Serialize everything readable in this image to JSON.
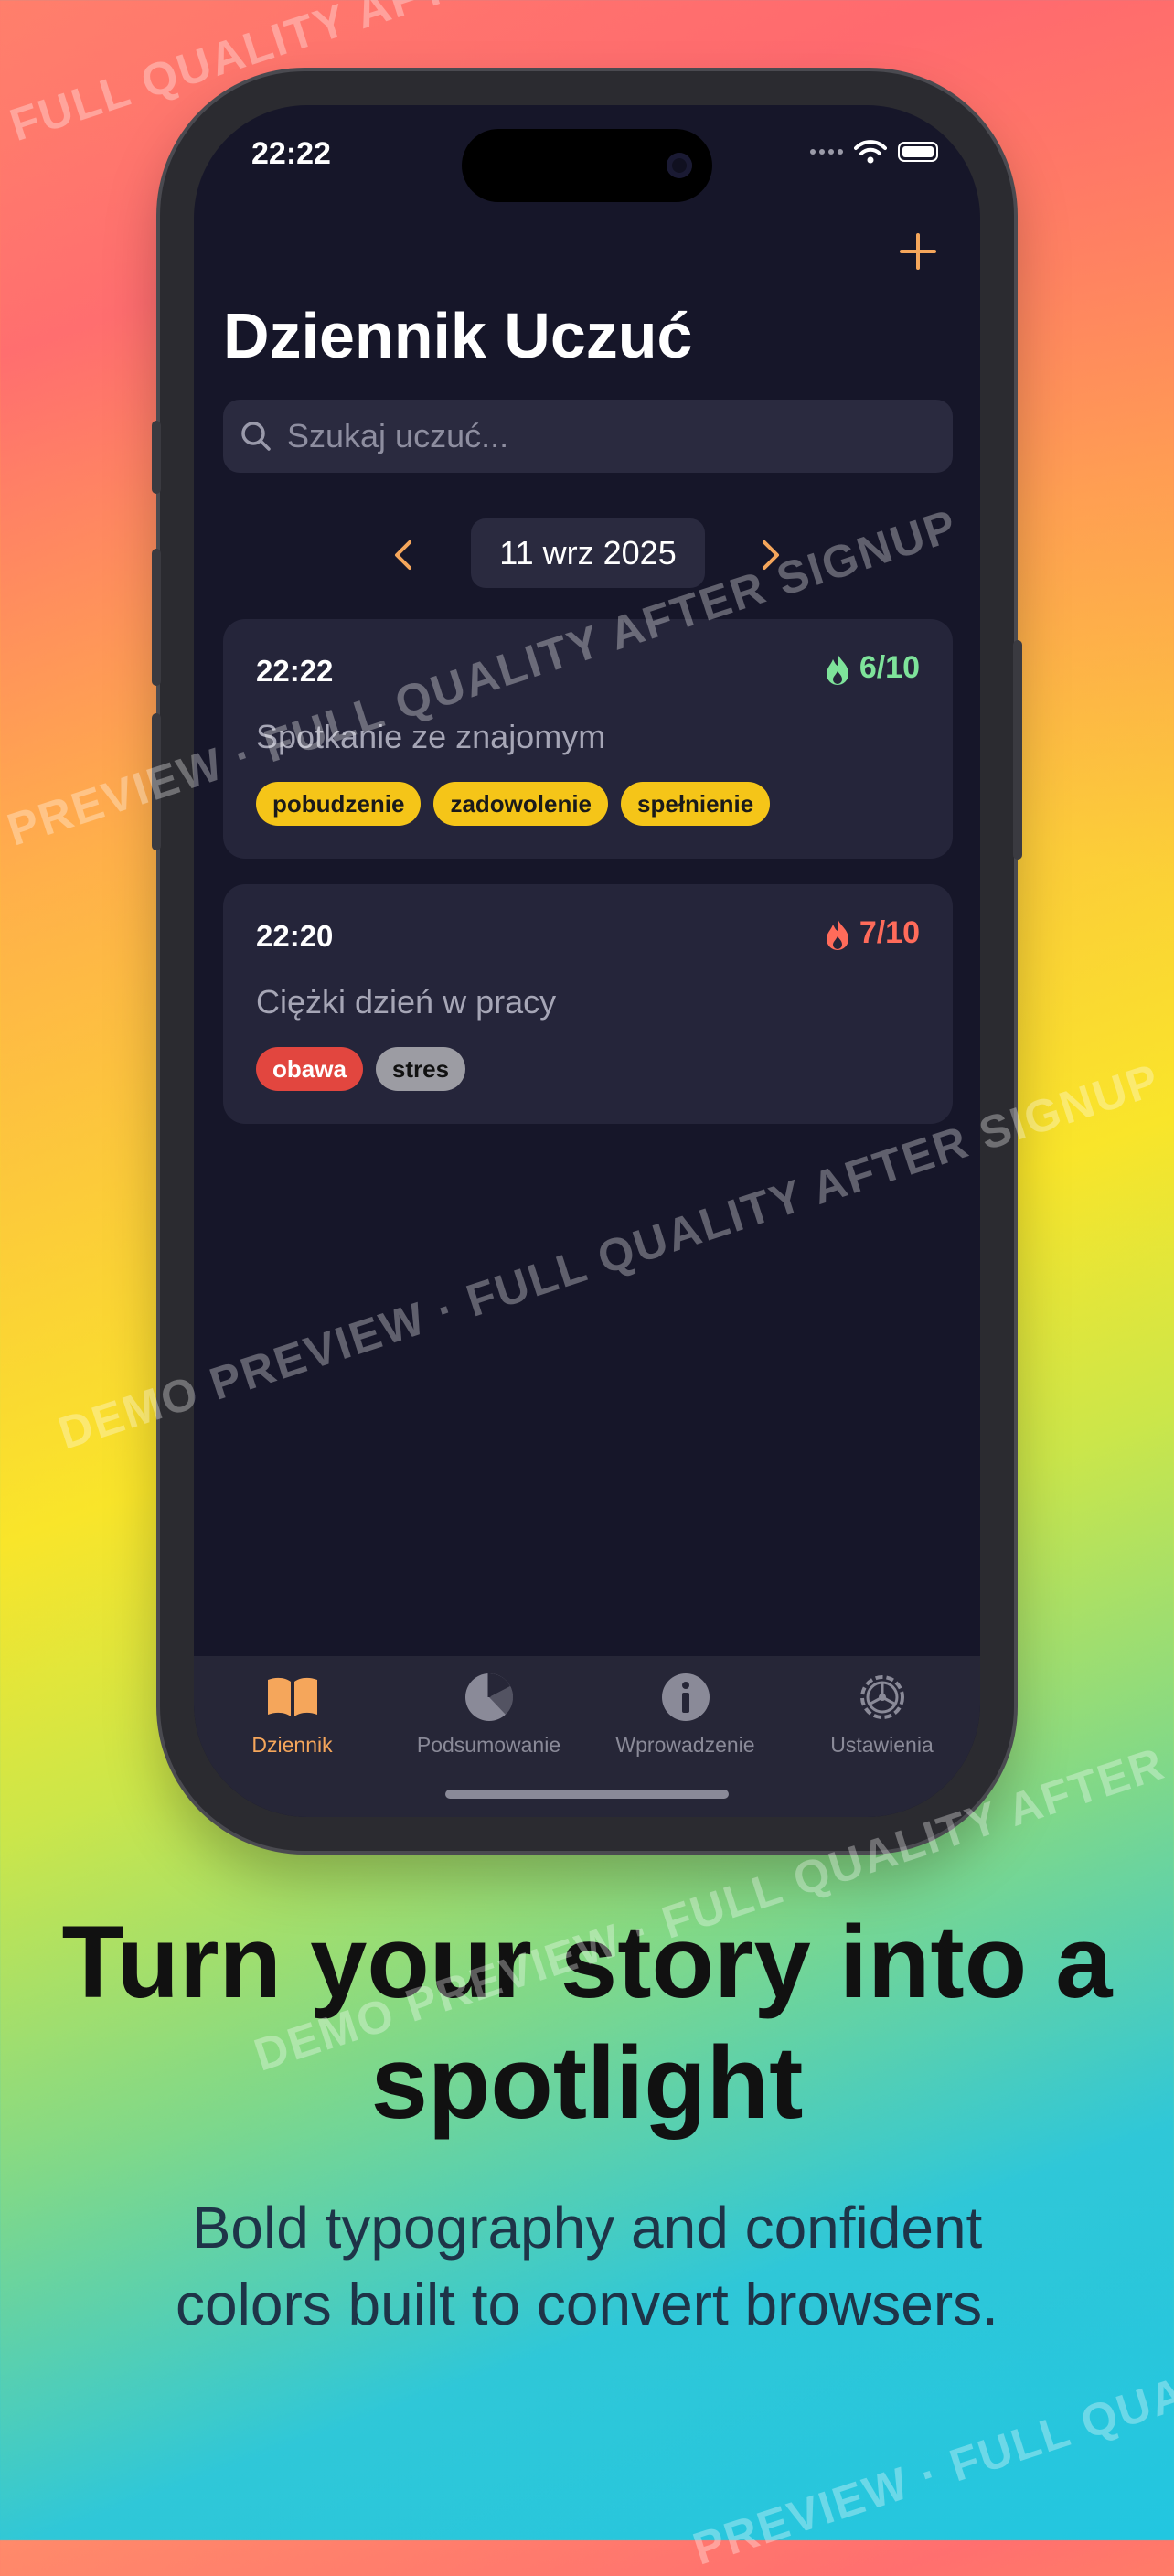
{
  "status_bar": {
    "time": "22:22"
  },
  "header": {
    "title": "Dziennik Uczuć",
    "add_icon": "plus-icon"
  },
  "search": {
    "placeholder": "Szukaj uczuć..."
  },
  "date_nav": {
    "date": "11 wrz 2025"
  },
  "entries": [
    {
      "time": "22:22",
      "intensity": "6/10",
      "intensity_color": "#7ee39a",
      "description": "Spotkanie ze znajomym",
      "tags": [
        {
          "label": "pobudzenie",
          "color": "#f5c518"
        },
        {
          "label": "zadowolenie",
          "color": "#f5c518"
        },
        {
          "label": "spełnienie",
          "color": "#f5c518"
        }
      ]
    },
    {
      "time": "22:20",
      "intensity": "7/10",
      "intensity_color": "#ff6b5a",
      "description": "Ciężki dzień w pracy",
      "tags": [
        {
          "label": "obawa",
          "color": "#e2463f"
        },
        {
          "label": "stres",
          "color": "#9c9ca3"
        }
      ]
    }
  ],
  "tabs": [
    {
      "label": "Dziennik",
      "icon": "book-icon",
      "active": true
    },
    {
      "label": "Podsumowanie",
      "icon": "pie-chart-icon",
      "active": false
    },
    {
      "label": "Wprowadzenie",
      "icon": "info-icon",
      "active": false
    },
    {
      "label": "Ustawienia",
      "icon": "gear-icon",
      "active": false
    }
  ],
  "colors": {
    "accent": "#f5a65b",
    "inactive": "#8a8a98",
    "screen_bg": "#161629"
  },
  "marketing": {
    "headline_line1": "Turn your story into a",
    "headline_line2": "spotlight",
    "subline_line1": "Bold typography and confident",
    "subline_line2": "colors built to convert browsers."
  },
  "watermark": {
    "text1": "· FULL QUALITY AFTER SIGNUP",
    "text2": "PREVIEW · FULL QUALITY AFTER SIGNUP",
    "text3": "DEMO PREVIEW · FULL QUALITY AFTER SIGNUP",
    "text4": "DEMO PREVIEW · FULL QUALITY AFTER SIGNUP",
    "text5": "PREVIEW · FULL QUALITY"
  }
}
